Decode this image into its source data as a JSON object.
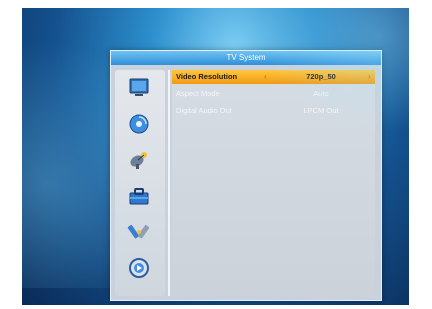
{
  "window": {
    "title": "TV System"
  },
  "sidebar": {
    "icons": [
      {
        "name": "tv-screen-icon"
      },
      {
        "name": "disc-icon"
      },
      {
        "name": "satellite-dish-icon"
      },
      {
        "name": "toolbox-icon"
      },
      {
        "name": "tools-icon"
      },
      {
        "name": "media-player-icon"
      }
    ]
  },
  "settings": {
    "rows": [
      {
        "label": "Video Resolution",
        "value": "720p_50",
        "selected": true
      },
      {
        "label": "Aspect Mode",
        "value": "Auto",
        "selected": false
      },
      {
        "label": "Digital Audio Out",
        "value": "LPCM Out",
        "selected": false
      }
    ],
    "arrow_left": "‹",
    "arrow_right": "›"
  },
  "colors": {
    "title_bar": "#2f8fd8",
    "highlight": "#f19a12",
    "panel": "#c9d2dc"
  }
}
